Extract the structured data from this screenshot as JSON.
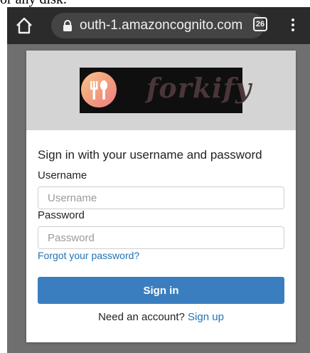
{
  "cropped_text": "or any disk.",
  "browser": {
    "url": "outh-1.amazoncognito.com",
    "tab_count": "26",
    "colors": {
      "toolbar": "#2b2b2b",
      "url_pill": "#444444"
    }
  },
  "logo": {
    "text": "forkify",
    "icon": "fork-spoon-icon"
  },
  "form": {
    "heading": "Sign in with your username and password",
    "username_label": "Username",
    "username_placeholder": "Username",
    "username_value": "",
    "password_label": "Password",
    "password_placeholder": "Password",
    "password_value": "",
    "forgot_link": "Forgot your password?",
    "signin_label": "Sign in",
    "signup_prompt": "Need an account?",
    "signup_link": "Sign up"
  },
  "colors": {
    "accent": "#3b7ec0",
    "link": "#1f73b7",
    "header_bg": "#d4d4d4",
    "page_bg": "#6f6f6f"
  }
}
